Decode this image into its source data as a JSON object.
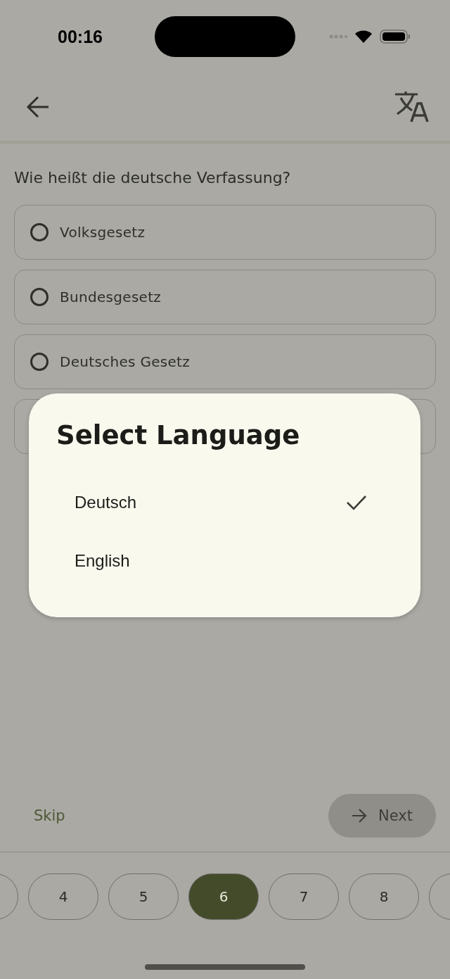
{
  "status_bar": {
    "time": "00:16"
  },
  "question": "Wie heißt die deutsche Verfassung?",
  "options": [
    {
      "label": "Volksgesetz",
      "selected": false
    },
    {
      "label": "Bundesgesetz",
      "selected": false
    },
    {
      "label": "Deutsches Gesetz",
      "selected": false
    }
  ],
  "actions": {
    "skip": "Skip",
    "next": "Next"
  },
  "pages": [
    {
      "label": "4",
      "selected": false
    },
    {
      "label": "5",
      "selected": false
    },
    {
      "label": "6",
      "selected": true
    },
    {
      "label": "7",
      "selected": false
    },
    {
      "label": "8",
      "selected": false
    }
  ],
  "dialog": {
    "title": "Select Language",
    "languages": [
      {
        "label": "Deutsch",
        "selected": true
      },
      {
        "label": "English",
        "selected": false
      }
    ]
  }
}
